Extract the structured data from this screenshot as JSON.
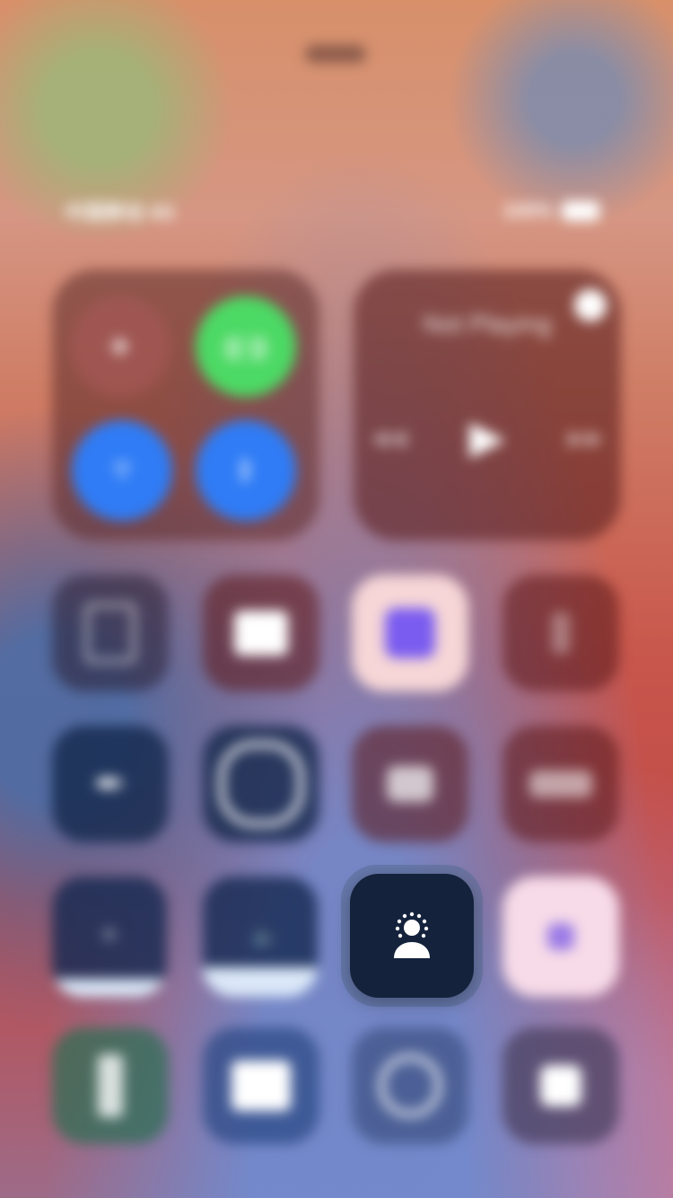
{
  "status_bar": {
    "carrier": "中国移动 4G",
    "battery_text": "100%"
  },
  "connectivity": {
    "airplane_icon": "airplane-icon",
    "cellular_icon": "antenna-icon",
    "wifi_icon": "wifi-icon",
    "bluetooth_icon": "bluetooth-icon"
  },
  "media": {
    "title": "Not Playing"
  },
  "controls": {
    "focus_tile_icon": "person-focus-icon"
  },
  "colors": {
    "cellular_green": "#4cd964",
    "accent_blue": "#2f7cf6",
    "focus_navy": "#14223c"
  },
  "brightness_level": 0.15,
  "volume_level": 0.25
}
